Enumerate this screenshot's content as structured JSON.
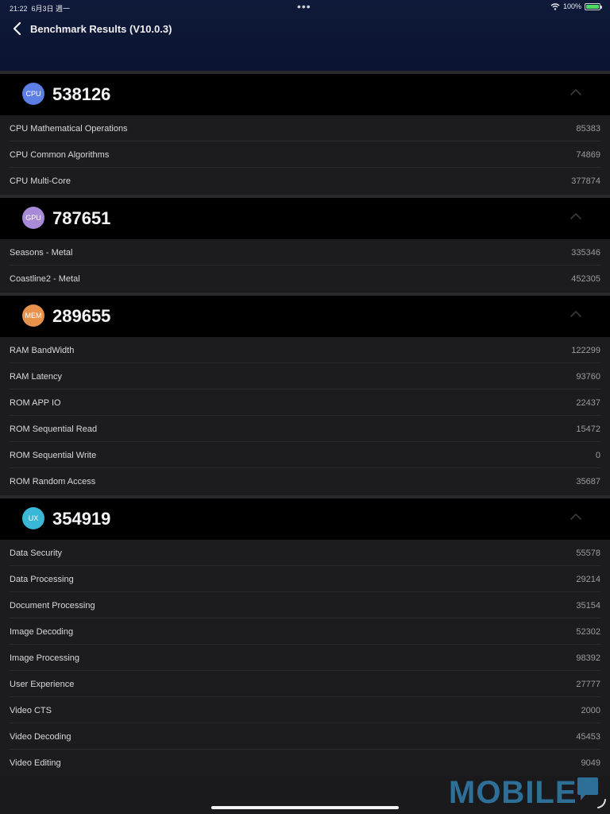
{
  "status_bar": {
    "time": "21:22",
    "date": "6月3日 週一",
    "battery": "100%"
  },
  "header": {
    "title": "Benchmark Results (V10.0.3)",
    "back_icon": "chevron-left-icon"
  },
  "sections": [
    {
      "badge": "CPU",
      "badge_color": "#5b7fe4",
      "score": "538126",
      "items": [
        {
          "label": "CPU Mathematical Operations",
          "value": "85383"
        },
        {
          "label": "CPU Common Algorithms",
          "value": "74869"
        },
        {
          "label": "CPU Multi-Core",
          "value": "377874"
        }
      ]
    },
    {
      "badge": "GPU",
      "badge_color": "#a98ad8",
      "score": "787651",
      "items": [
        {
          "label": "Seasons - Metal",
          "value": "335346"
        },
        {
          "label": "Coastline2 - Metal",
          "value": "452305"
        }
      ]
    },
    {
      "badge": "MEM",
      "badge_color": "#e8914a",
      "score": "289655",
      "items": [
        {
          "label": "RAM BandWidth",
          "value": "122299"
        },
        {
          "label": "RAM Latency",
          "value": "93760"
        },
        {
          "label": "ROM APP IO",
          "value": "22437"
        },
        {
          "label": "ROM Sequential Read",
          "value": "15472"
        },
        {
          "label": "ROM Sequential Write",
          "value": "0"
        },
        {
          "label": "ROM Random Access",
          "value": "35687"
        }
      ]
    },
    {
      "badge": "UX",
      "badge_color": "#3ab6d6",
      "score": "354919",
      "items": [
        {
          "label": "Data Security",
          "value": "55578"
        },
        {
          "label": "Data Processing",
          "value": "29214"
        },
        {
          "label": "Document Processing",
          "value": "35154"
        },
        {
          "label": "Image Decoding",
          "value": "52302"
        },
        {
          "label": "Image Processing",
          "value": "98392"
        },
        {
          "label": "User Experience",
          "value": "27777"
        },
        {
          "label": "Video CTS",
          "value": "2000"
        },
        {
          "label": "Video Decoding",
          "value": "45453"
        },
        {
          "label": "Video Editing",
          "value": "9049"
        }
      ]
    }
  ],
  "watermark": "MOBILE"
}
